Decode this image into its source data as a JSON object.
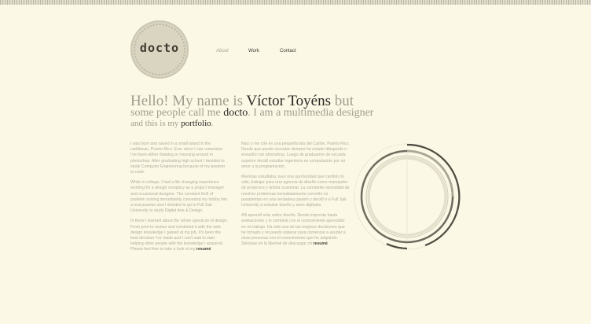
{
  "logo": {
    "text": "docto"
  },
  "nav": {
    "items": [
      {
        "label": "About",
        "active": true
      },
      {
        "label": "Work",
        "active": false
      },
      {
        "label": "Contact",
        "active": false
      }
    ]
  },
  "headline": {
    "line1_a": "Hello! My name is ",
    "line1_name": "Víctor Toyéns",
    "line1_b": " but",
    "line2_a": "some people call me ",
    "line2_nick": "docto",
    "line2_b": ". I am a multimedia designer",
    "line3_a": "and this is my ",
    "line3_portfolio": "portfolio",
    "line3_b": "."
  },
  "bio_en": {
    "p1": "I was born and raised in a small island in the caribbean, Puerto Rico. Ever since I can remember I've been either drawing or messing around in photoshop. After graduating high school I decided to study Computer Engineering because of my passion to code.",
    "p2": "While in college, I had a life changing experience working for a design company as a project manager and occasional designer. The constant thrill of problem solving immediately converted my hobby into a real passion and I decided to go to Full Sail University to study Digital Arts & Design.",
    "p3": "In there I learned about the whole spectrum of design. From print to motion and combined it with the web design knowledge I gained at my job. It's been the best decision I've made and I can't wait to start helping other people with the knowledge I acquired. Please feel free to take a look at my ",
    "resume": "resumé"
  },
  "bio_es": {
    "p1": "Nací y me crié en una pequeña isla del Caribe, Puerto Rico. Desde que puedo recordar siempre he estado dibujando o envuelto con photoshop. Luego de graduarme de escuela superior decidí estudiar ingeniería en computación por mi amor a la programación.",
    "p2": "Mientras estudiaba, tuve una oportunidad que cambió mi vida, trabajar para una agencia de diseño como manejador de proyectos y artista ocasional. La constante necesidad de resolver problemas inmediatamente convirtió mi pasatiempo en una verdadera pasión y decidí ir a Full Sail University a estudiar diseño y artes digitales.",
    "p3": "Allí aprendí más sobre diseño. Desde imprenta hasta animaciones y lo combiné con el conocimiento aprendido en mi trabajo. Ha sido una de las mejores decisiones que he tomado y no puedo esperar para comenzar a ayudar a otras personas con el conocimiento que he adquirido. Siéntase en la libertad de descargar mi ",
    "resume": "resumé"
  },
  "colors": {
    "background": "#fbf8e6",
    "headline_light": "#a19e8e",
    "headline_dark": "#2a2822",
    "body_text": "#b1ae9f"
  }
}
